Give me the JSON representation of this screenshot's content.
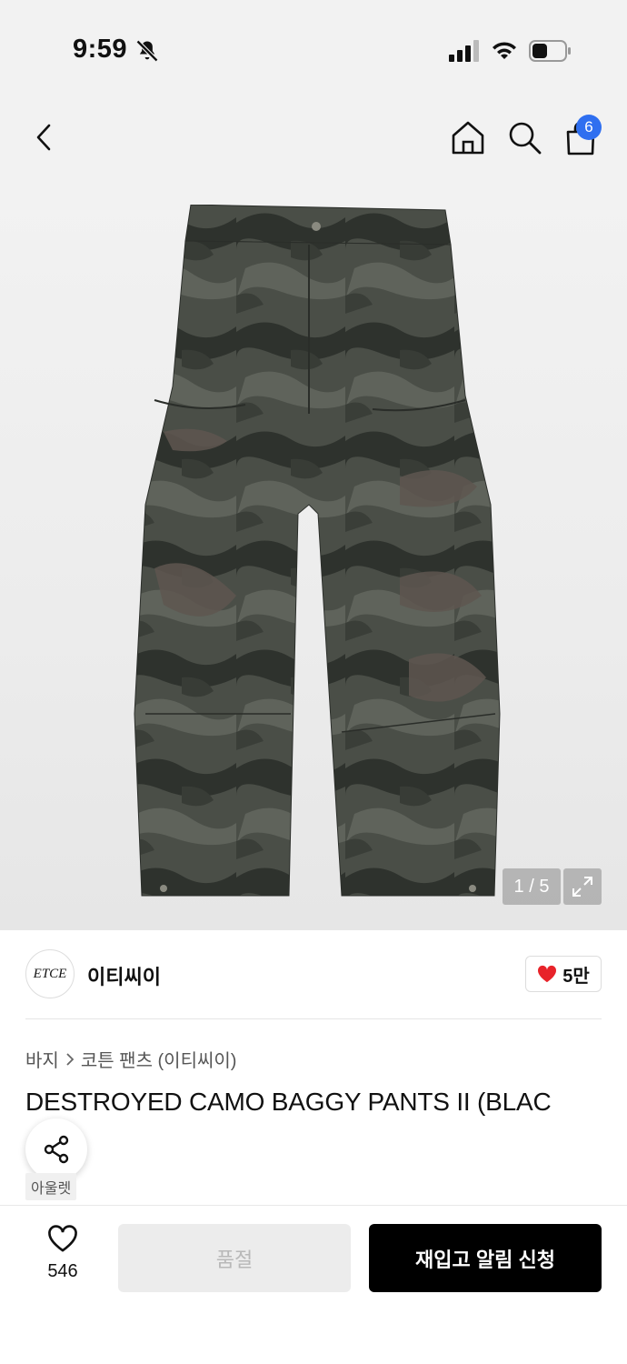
{
  "status_bar": {
    "time": "9:59"
  },
  "nav": {
    "cart_count": "6"
  },
  "hero": {
    "image_counter": "1 / 5"
  },
  "brand": {
    "logo_text": "ETCE",
    "name": "이티씨이",
    "likes": "5만"
  },
  "breadcrumb": {
    "category": "바지",
    "subcategory": "코튼 팬츠 (이티씨이)"
  },
  "product": {
    "title": "DESTROYED CAMO BAGGY PANTS II (BLAC",
    "tag": "아울렛"
  },
  "bottom_bar": {
    "wish_count": "546",
    "soldout_label": "품절",
    "restock_label": "재입고 알림 신청"
  },
  "colors": {
    "accent_badge": "#2f6ff0",
    "heart": "#e8232a",
    "primary_button": "#000000"
  }
}
